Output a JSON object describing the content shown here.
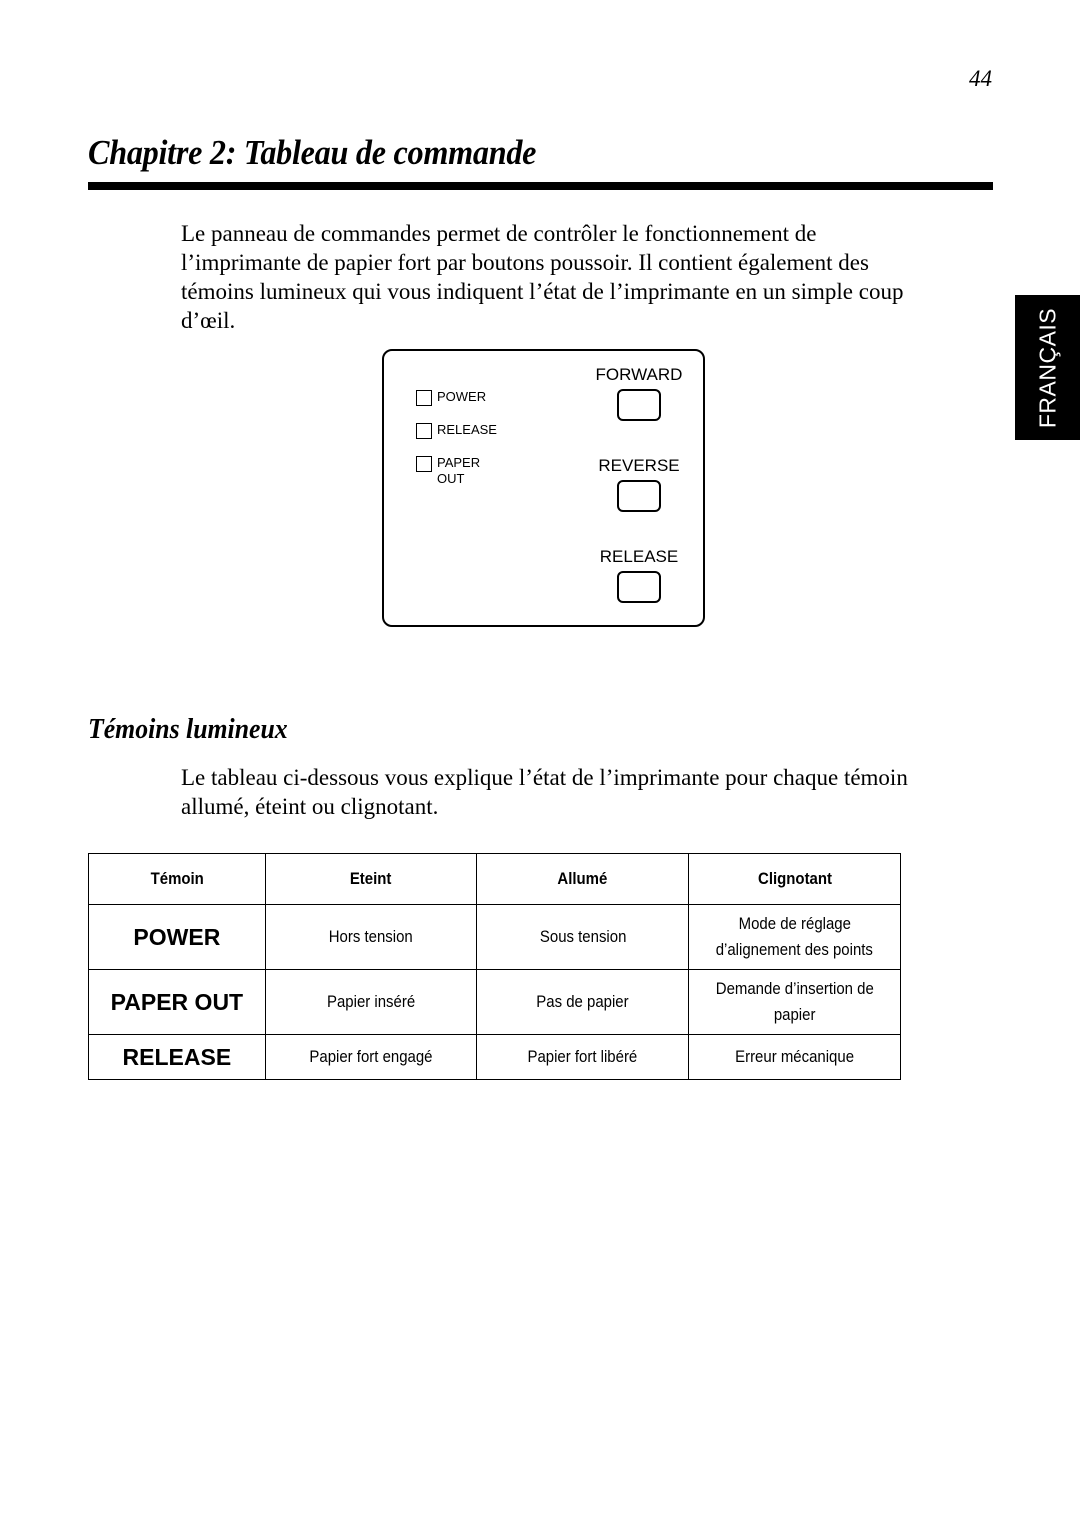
{
  "page_number": "44",
  "chapter": {
    "title": "Chapitre 2:  Tableau de commande"
  },
  "intro_lines": [
    "Le panneau de commandes permet de contrôler le fonctionnement de",
    "l’imprimante de papier fort par boutons poussoir. Il contient également des",
    "témoins lumineux qui vous indiquent l’état de l’imprimante en un simple coup",
    "d’œil."
  ],
  "language_tab": "FRANÇAIS",
  "control_panel": {
    "indicators": [
      {
        "label_lines": [
          "POWER"
        ]
      },
      {
        "label_lines": [
          "RELEASE"
        ]
      },
      {
        "label_lines": [
          "PAPER",
          "OUT"
        ]
      }
    ],
    "buttons": [
      {
        "label": "FORWARD"
      },
      {
        "label": "REVERSE"
      },
      {
        "label": "RELEASE"
      }
    ]
  },
  "section": {
    "title": "Témoins lumineux",
    "body_lines": [
      "Le tableau ci-dessous vous explique l’état de l’imprimante pour chaque témoin",
      "allumé, éteint ou clignotant."
    ]
  },
  "table": {
    "headers": [
      "Témoin",
      "Eteint",
      "Allumé",
      "Clignotant"
    ],
    "rows": [
      {
        "led": "POWER",
        "off": "Hors tension",
        "on": "Sous tension",
        "blink_lines": [
          "Mode de réglage",
          "d’alignement des points"
        ]
      },
      {
        "led": "PAPER OUT",
        "off": "Papier inséré",
        "on": "Pas de papier",
        "blink_lines": [
          "Demande d’insertion de",
          "papier"
        ]
      },
      {
        "led": "RELEASE",
        "off": "Papier fort engagé",
        "on": "Papier fort libéré",
        "blink_lines": [
          "Erreur mécanique"
        ]
      }
    ]
  }
}
